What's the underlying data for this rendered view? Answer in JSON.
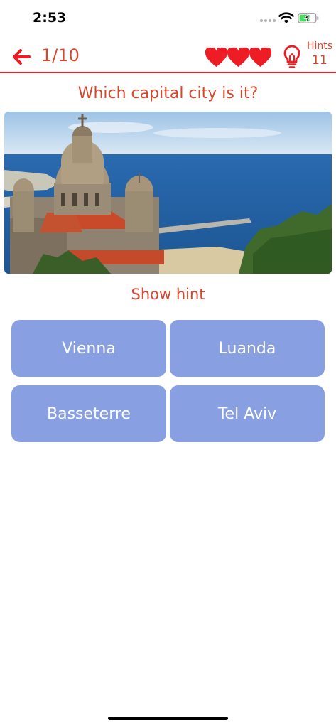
{
  "status_bar": {
    "time": "2:53",
    "icons": [
      "cellular-signal-icon",
      "wifi-icon",
      "battery-charging-icon"
    ]
  },
  "nav": {
    "back_icon": "arrow-left-icon",
    "progress": "1/10",
    "lives": 3,
    "heart_icon": "heart-icon",
    "hint_icon": "lightbulb-icon",
    "hints_label": "Hints",
    "hints_count": "11"
  },
  "quiz": {
    "question": "Which capital city is it?",
    "show_hint": "Show hint",
    "answers": [
      "Vienna",
      "Luanda",
      "Basseterre",
      "Tel Aviv"
    ]
  },
  "colors": {
    "accent": "#d6462d",
    "heart_red": "#ee1c24",
    "divider": "#e0262a",
    "answer_bg": "#889fe2",
    "answer_text": "#ffffff"
  }
}
